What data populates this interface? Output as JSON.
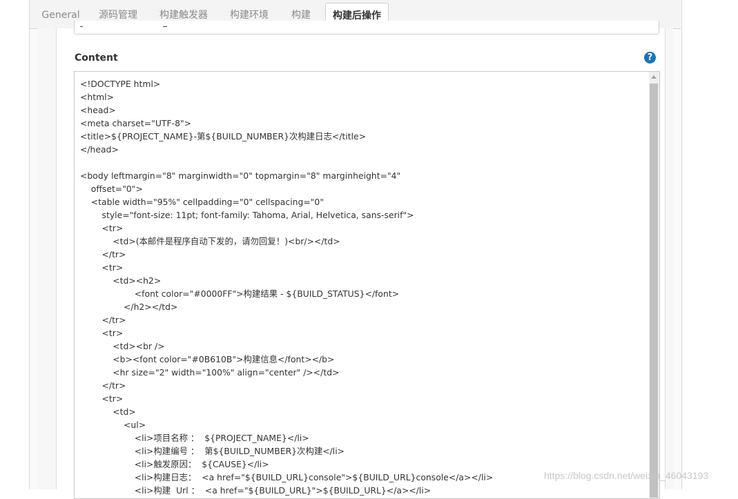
{
  "tabs": [
    {
      "label": "General"
    },
    {
      "label": "源码管理"
    },
    {
      "label": "构建触发器"
    },
    {
      "label": "构建环境"
    },
    {
      "label": "构建"
    },
    {
      "label": "构建后操作"
    }
  ],
  "content": {
    "label": "Content",
    "help": "?",
    "value": "<!DOCTYPE html>\n<html>\n<head>\n<meta charset=\"UTF-8\">\n<title>${PROJECT_NAME}-第${BUILD_NUMBER}次构建日志</title>\n</head>\n\n<body leftmargin=\"8\" marginwidth=\"0\" topmargin=\"8\" marginheight=\"4\"\n    offset=\"0\">\n    <table width=\"95%\" cellpadding=\"0\" cellspacing=\"0\"\n        style=\"font-size: 11pt; font-family: Tahoma, Arial, Helvetica, sans-serif\">\n        <tr>\n            <td>(本邮件是程序自动下发的，请勿回复！)<br/></td>\n        </tr>\n        <tr>\n            <td><h2>\n                    <font color=\"#0000FF\">构建结果 - ${BUILD_STATUS}</font>\n                </h2></td>\n        </tr>\n        <tr>\n            <td><br />\n            <b><font color=\"#0B610B\">构建信息</font></b>\n            <hr size=\"2\" width=\"100%\" align=\"center\" /></td>\n        </tr>\n        <tr>\n            <td>\n                <ul>\n                    <li>项目名称 ：  ${PROJECT_NAME}</li>\n                    <li>构建编号 ：  第${BUILD_NUMBER}次构建</li>\n                    <li>触发原因：  ${CAUSE}</li>\n                    <li>构建日志：  <a href=\"${BUILD_URL}console\">${BUILD_URL}console</a></li>\n                    <li>构建  Url ：  <a href=\"${BUILD_URL}\">${BUILD_URL}</a></li>"
  },
  "watermark": "https://blog.csdn.net/weixin_46043193",
  "colors": {
    "help_icon": "#1a73b8",
    "tab_active_text": "#333333",
    "tab_inactive_text": "#8a8a8a"
  }
}
